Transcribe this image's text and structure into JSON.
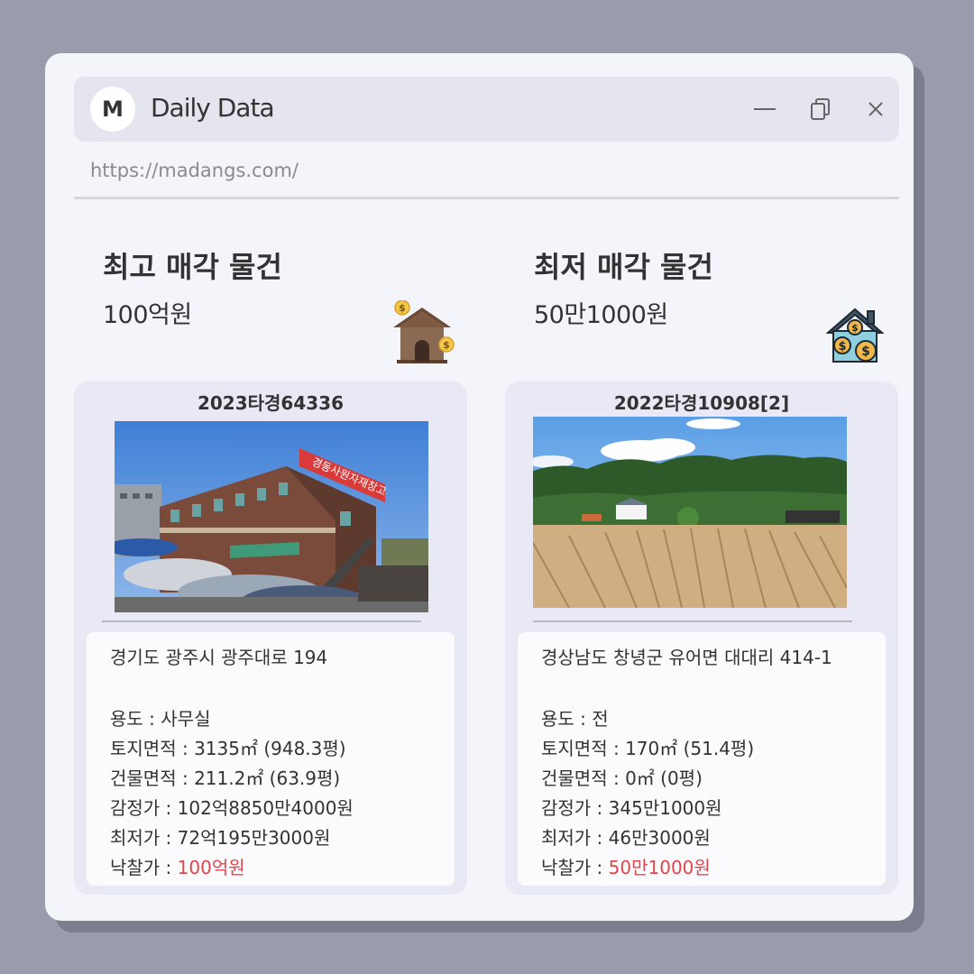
{
  "window": {
    "logo_letter": "M",
    "app_title": "Daily Data",
    "url": "https://madangs.com/"
  },
  "highest": {
    "heading": "최고 매각 물건",
    "price": "100억원",
    "icon": "house-coin-icon",
    "card": {
      "case_no": "2023타경64336",
      "address": "경기도 광주시 광주대로 194",
      "specs": [
        {
          "label": "용도",
          "value": "사무실"
        },
        {
          "label": "토지면적",
          "value": "3135㎡ (948.3평)"
        },
        {
          "label": "건물면적",
          "value": "211.2㎡ (63.9평)"
        },
        {
          "label": "감정가",
          "value": "102억8850만4000원"
        },
        {
          "label": "최저가",
          "value": "72억195만3000원"
        },
        {
          "label": "낙찰가",
          "value": "100억원"
        }
      ]
    }
  },
  "lowest": {
    "heading": "최저 매각 물건",
    "price": "50만1000원",
    "icon": "house-money-icon",
    "card": {
      "case_no": "2022타경10908[2]",
      "address": "경상남도 창녕군 유어면 대대리 414-1",
      "specs": [
        {
          "label": "용도",
          "value": "전"
        },
        {
          "label": "토지면적",
          "value": "170㎡ (51.4평)"
        },
        {
          "label": "건물면적",
          "value": "0㎡ (0평)"
        },
        {
          "label": "감정가",
          "value": "345만1000원"
        },
        {
          "label": "최저가",
          "value": "46만3000원"
        },
        {
          "label": "낙찰가",
          "value": "50만1000원"
        }
      ]
    }
  },
  "colors": {
    "accent_sold": "#e0464b",
    "background": "#9a9cae",
    "window": "#f4f5fb",
    "card": "#e8e9f5"
  }
}
